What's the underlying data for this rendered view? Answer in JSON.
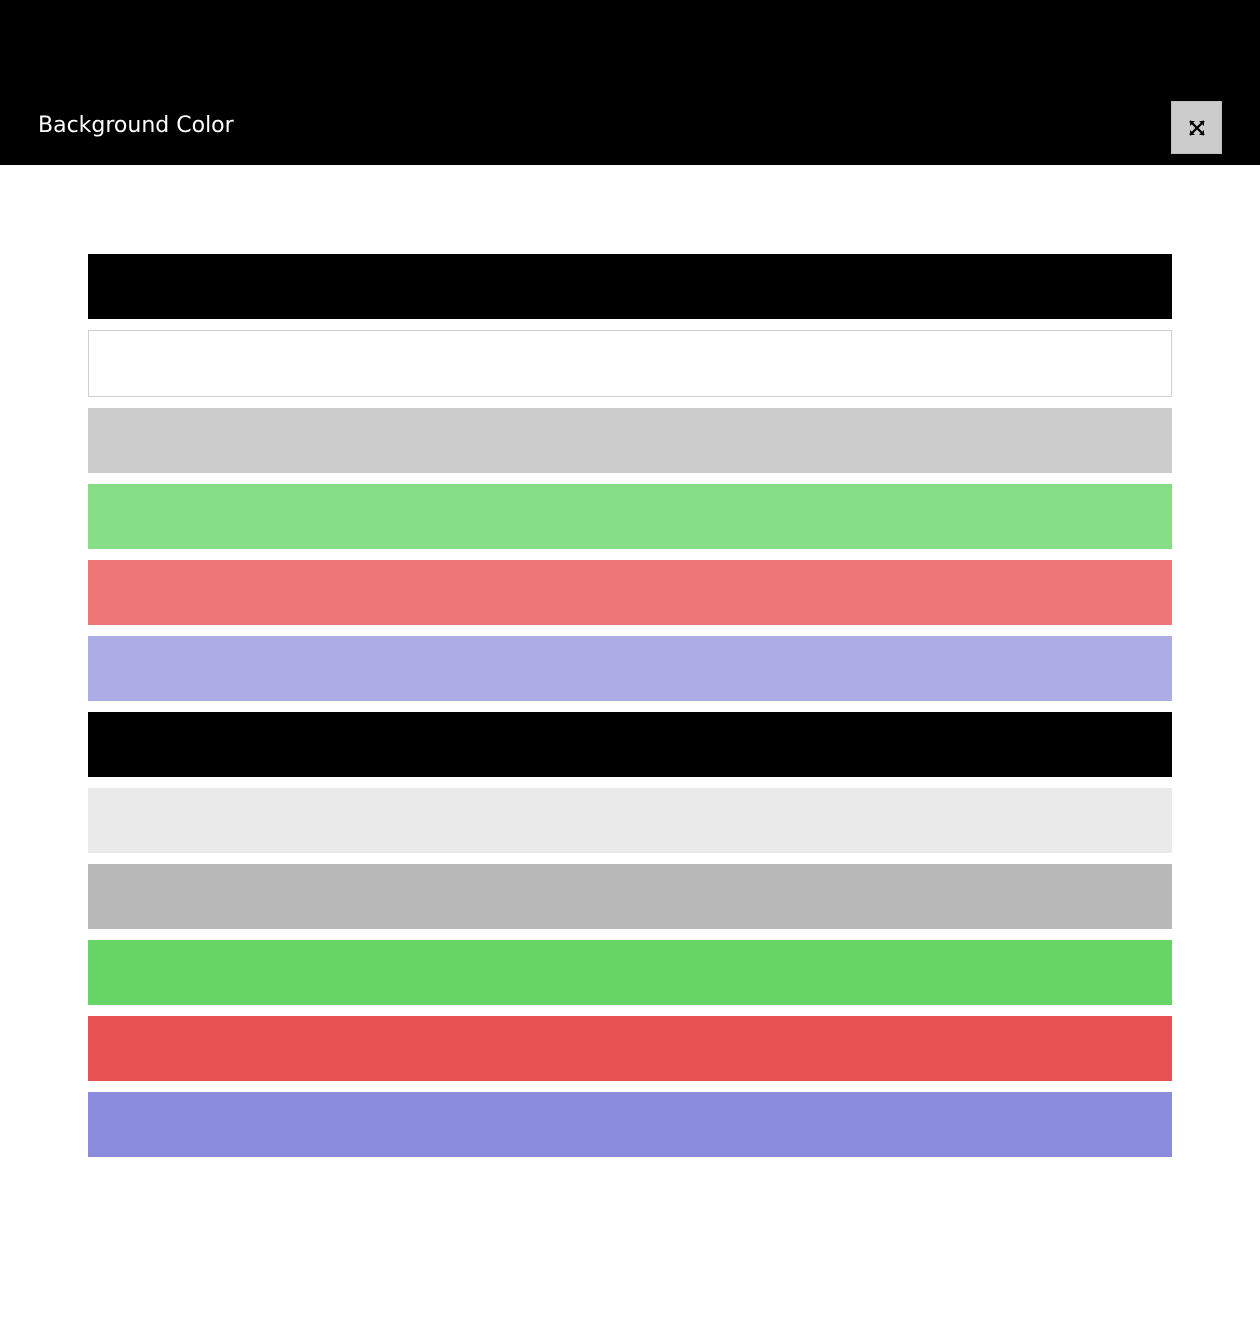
{
  "header": {
    "title": "Background Color",
    "background": "#000000",
    "toggle_icon": "expand-icon"
  },
  "swatches": [
    {
      "color": "#000000"
    },
    {
      "color": "#ffffff",
      "border": "#cfcfcf"
    },
    {
      "color": "#cccccc"
    },
    {
      "color": "#86de86"
    },
    {
      "color": "#ee7676"
    },
    {
      "color": "#adade6"
    },
    {
      "color": "#000000"
    },
    {
      "color": "#eaeaea"
    },
    {
      "color": "#b8b8b8"
    },
    {
      "color": "#66d566"
    },
    {
      "color": "#e95252"
    },
    {
      "color": "#8c8cde"
    }
  ]
}
